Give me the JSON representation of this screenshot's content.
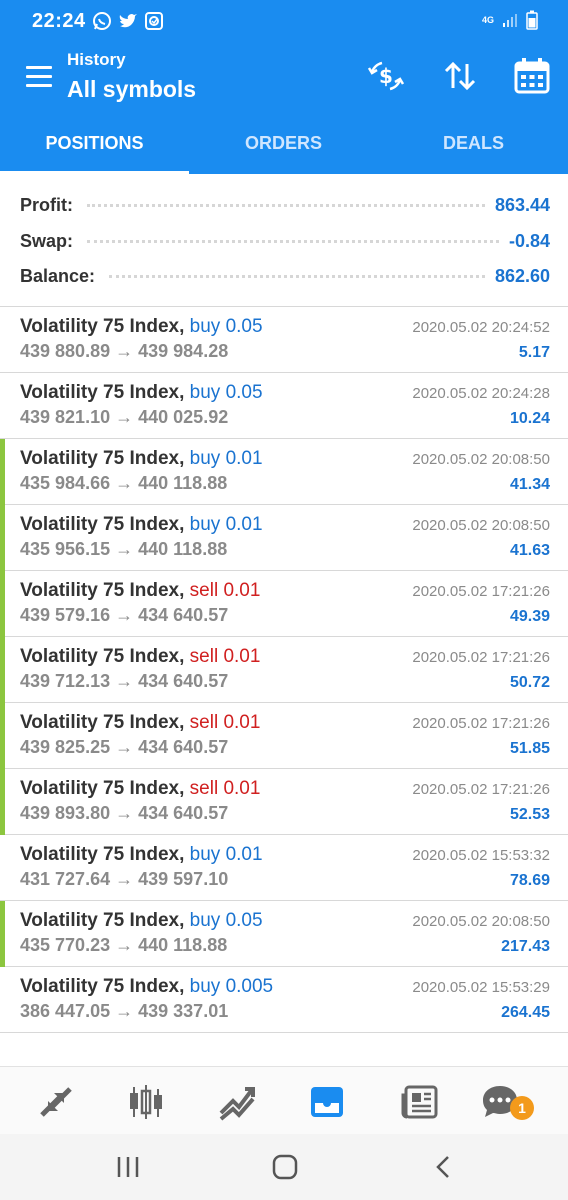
{
  "status": {
    "time": "22:24",
    "network": "4G"
  },
  "header": {
    "subtitle": "History",
    "title": "All symbols"
  },
  "tabs": [
    {
      "label": "POSITIONS",
      "active": true
    },
    {
      "label": "ORDERS",
      "active": false
    },
    {
      "label": "DEALS",
      "active": false
    }
  ],
  "summary": {
    "profit_label": "Profit:",
    "profit": "863.44",
    "swap_label": "Swap:",
    "swap": "-0.84",
    "balance_label": "Balance:",
    "balance": "862.60"
  },
  "deals": [
    {
      "symbol": "Volatility 75 Index,",
      "type": "buy",
      "volume": "0.05",
      "open": "439 880.89",
      "close": "439 984.28",
      "time": "2020.05.02 20:24:52",
      "profit": "5.17",
      "marked": false
    },
    {
      "symbol": "Volatility 75 Index,",
      "type": "buy",
      "volume": "0.05",
      "open": "439 821.10",
      "close": "440 025.92",
      "time": "2020.05.02 20:24:28",
      "profit": "10.24",
      "marked": false
    },
    {
      "symbol": "Volatility 75 Index,",
      "type": "buy",
      "volume": "0.01",
      "open": "435 984.66",
      "close": "440 118.88",
      "time": "2020.05.02 20:08:50",
      "profit": "41.34",
      "marked": true
    },
    {
      "symbol": "Volatility 75 Index,",
      "type": "buy",
      "volume": "0.01",
      "open": "435 956.15",
      "close": "440 118.88",
      "time": "2020.05.02 20:08:50",
      "profit": "41.63",
      "marked": true
    },
    {
      "symbol": "Volatility 75 Index,",
      "type": "sell",
      "volume": "0.01",
      "open": "439 579.16",
      "close": "434 640.57",
      "time": "2020.05.02 17:21:26",
      "profit": "49.39",
      "marked": true
    },
    {
      "symbol": "Volatility 75 Index,",
      "type": "sell",
      "volume": "0.01",
      "open": "439 712.13",
      "close": "434 640.57",
      "time": "2020.05.02 17:21:26",
      "profit": "50.72",
      "marked": true
    },
    {
      "symbol": "Volatility 75 Index,",
      "type": "sell",
      "volume": "0.01",
      "open": "439 825.25",
      "close": "434 640.57",
      "time": "2020.05.02 17:21:26",
      "profit": "51.85",
      "marked": true
    },
    {
      "symbol": "Volatility 75 Index,",
      "type": "sell",
      "volume": "0.01",
      "open": "439 893.80",
      "close": "434 640.57",
      "time": "2020.05.02 17:21:26",
      "profit": "52.53",
      "marked": true
    },
    {
      "symbol": "Volatility 75 Index,",
      "type": "buy",
      "volume": "0.01",
      "open": "431 727.64",
      "close": "439 597.10",
      "time": "2020.05.02 15:53:32",
      "profit": "78.69",
      "marked": false
    },
    {
      "symbol": "Volatility 75 Index,",
      "type": "buy",
      "volume": "0.05",
      "open": "435 770.23",
      "close": "440 118.88",
      "time": "2020.05.02 20:08:50",
      "profit": "217.43",
      "marked": true
    },
    {
      "symbol": "Volatility 75 Index,",
      "type": "buy",
      "volume": "0.005",
      "open": "386 447.05",
      "close": "439 337.01",
      "time": "2020.05.02 15:53:29",
      "profit": "264.45",
      "marked": false
    }
  ],
  "nav": {
    "chat_badge": "1"
  },
  "icons": {
    "menu": "menu-icon",
    "currency": "currency-exchange-icon",
    "sort": "sort-icon",
    "calendar": "calendar-icon",
    "quotes": "quotes-icon",
    "chart": "candlestick-chart-icon",
    "trade": "trade-icon",
    "history": "history-inbox-icon",
    "news": "news-icon",
    "chat": "chat-icon"
  },
  "colors": {
    "accent": "#1a8cf0",
    "profit": "#1a73d0",
    "buy": "#1a73d0",
    "sell": "#d02020",
    "marker": "#8cc63f",
    "badge": "#f39a1b"
  }
}
